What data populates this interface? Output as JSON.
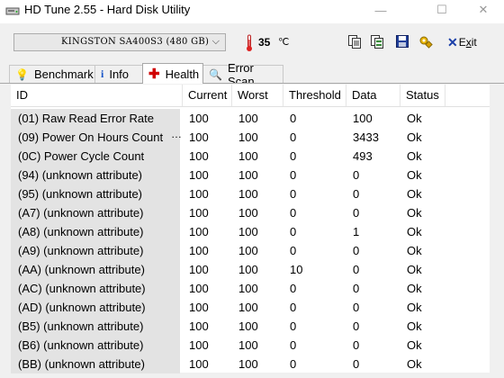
{
  "window": {
    "title": "HD Tune 2.55 - Hard Disk Utility",
    "minimize": "—",
    "maximize": "☐",
    "close": "✕"
  },
  "toolbar": {
    "drive": "KINGSTON SA400S3 (480 GB)",
    "temperature": "35",
    "temp_unit_icon": "℃",
    "exit_label": "Exit",
    "exit_underlined_char": "x"
  },
  "tabs": [
    {
      "label": "Benchmark",
      "icon": "lightbulb-icon"
    },
    {
      "label": "Info",
      "icon": "info-icon"
    },
    {
      "label": "Health",
      "icon": "cross-icon",
      "active": true
    },
    {
      "label": "Error Scan",
      "icon": "magnifier-icon"
    }
  ],
  "table": {
    "headers": [
      "ID",
      "Current",
      "Worst",
      "Threshold",
      "Data",
      "Status"
    ],
    "rows": [
      [
        "(01) Raw Read Error Rate",
        "100",
        "100",
        "0",
        "100",
        "Ok"
      ],
      [
        "(09) Power On Hours Count",
        "100",
        "100",
        "0",
        "3433",
        "Ok"
      ],
      [
        "(0C) Power Cycle Count",
        "100",
        "100",
        "0",
        "493",
        "Ok"
      ],
      [
        "(94) (unknown attribute)",
        "100",
        "100",
        "0",
        "0",
        "Ok"
      ],
      [
        "(95) (unknown attribute)",
        "100",
        "100",
        "0",
        "0",
        "Ok"
      ],
      [
        "(A7) (unknown attribute)",
        "100",
        "100",
        "0",
        "0",
        "Ok"
      ],
      [
        "(A8) (unknown attribute)",
        "100",
        "100",
        "0",
        "1",
        "Ok"
      ],
      [
        "(A9) (unknown attribute)",
        "100",
        "100",
        "0",
        "0",
        "Ok"
      ],
      [
        "(AA) (unknown attribute)",
        "100",
        "100",
        "10",
        "0",
        "Ok"
      ],
      [
        "(AC) (unknown attribute)",
        "100",
        "100",
        "0",
        "0",
        "Ok"
      ],
      [
        "(AD) (unknown attribute)",
        "100",
        "100",
        "0",
        "0",
        "Ok"
      ],
      [
        "(B5) (unknown attribute)",
        "100",
        "100",
        "0",
        "0",
        "Ok"
      ],
      [
        "(B6) (unknown attribute)",
        "100",
        "100",
        "0",
        "0",
        "Ok"
      ],
      [
        "(BB) (unknown attribute)",
        "100",
        "100",
        "0",
        "0",
        "Ok"
      ]
    ]
  }
}
